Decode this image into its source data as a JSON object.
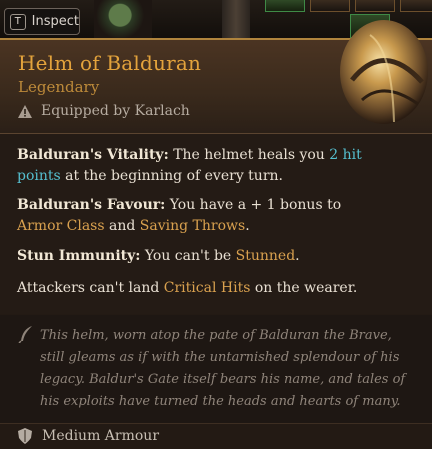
{
  "top_bar": {
    "inspect_key": "T",
    "inspect_label": "Inspect"
  },
  "item": {
    "name": "Helm of Balduran",
    "rarity": "Legendary",
    "equipped_by": "Equipped by Karlach",
    "properties": [
      {
        "heading": "Balduran's Vitality:",
        "text_before": " The helmet heals you ",
        "highlight": "2 hit points",
        "text_after": " at the beginning of every turn."
      },
      {
        "heading": "Balduran's Favour:",
        "text_before": " You have a + 1 bonus to ",
        "highlight_1": "Armor Class",
        "text_middle": " and ",
        "highlight_2": "Saving Throws",
        "text_after": "."
      },
      {
        "heading": "Stun Immunity:",
        "text_before": " You can't be ",
        "highlight": "Stunned",
        "text_after": "."
      },
      {
        "text_before": "Attackers can't land ",
        "highlight": "Critical Hits",
        "text_after": " on the wearer."
      }
    ],
    "flavor_text": "This helm, worn atop the pate of Balduran the Brave, still gleams as if with the untarnished splendour of his legacy. Baldur's Gate itself bears his name, and tales of his exploits have turned the heads and hearts of many.",
    "armour_type": "Medium Armour"
  },
  "colors": {
    "title": "#e3a33c",
    "rarity": "#bd8a3a",
    "teal_highlight": "#55bfcf",
    "gold_highlight": "#d9a14f"
  },
  "icons": {
    "warning": "warning-icon",
    "quill": "quill-icon",
    "armour": "shield-icon"
  }
}
